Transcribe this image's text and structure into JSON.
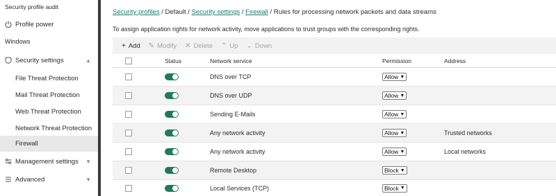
{
  "sidebar": {
    "items": [
      {
        "label": "Security profile audit",
        "type": "item",
        "icon": ""
      },
      {
        "label": "Profile power",
        "type": "item",
        "icon": "power-icon"
      },
      {
        "label": "Windows",
        "type": "section"
      },
      {
        "label": "Security settings",
        "type": "group",
        "icon": "shield-icon",
        "chevron": "up"
      },
      {
        "label": "File Threat Protection",
        "type": "subitem"
      },
      {
        "label": "Mail Threat Protection",
        "type": "subitem"
      },
      {
        "label": "Web Threat Protection",
        "type": "subitem"
      },
      {
        "label": "Network Threat Protection",
        "type": "subitem"
      },
      {
        "label": "Firewall",
        "type": "subitem",
        "active": true
      },
      {
        "label": "Management settings",
        "type": "group",
        "icon": "sliders-icon",
        "chevron": "down"
      },
      {
        "label": "Advanced",
        "type": "group",
        "icon": "list-icon",
        "chevron": "down"
      }
    ]
  },
  "breadcrumb": {
    "link1": "Security profiles",
    "sep1": "/",
    "plain1": "Default",
    "sep2": "/",
    "link2": "Security settings",
    "sep3": "/",
    "link3": "Firewall",
    "sep4": "/",
    "current": "Rules for processing network packets and data streams"
  },
  "description": "To assign application rights for network activity, move applications to trust groups with the corresponding rights.",
  "toolbar": {
    "add": "Add",
    "modify": "Modify",
    "delete": "Delete",
    "up": "Up",
    "down": "Down"
  },
  "table": {
    "headers": {
      "status": "Status",
      "service": "Network service",
      "permission": "Permission",
      "address": "Address"
    },
    "rows": [
      {
        "service": "DNS over TCP",
        "permission": "Allow",
        "address": "",
        "enabled": true
      },
      {
        "service": "DNS over UDP",
        "permission": "Allow",
        "address": "",
        "enabled": true
      },
      {
        "service": "Sending E-Mails",
        "permission": "Allow",
        "address": "",
        "enabled": true
      },
      {
        "service": "Any network activity",
        "permission": "Allow",
        "address": "Trusted networks",
        "enabled": true
      },
      {
        "service": "Any network activity",
        "permission": "Allow",
        "address": "Local networks",
        "enabled": true
      },
      {
        "service": "Remote Desktop",
        "permission": "Block",
        "address": "",
        "enabled": true
      },
      {
        "service": "Local Services (TCP)",
        "permission": "Block",
        "address": "",
        "enabled": true
      }
    ]
  },
  "colors": {
    "accent": "#1f7a5e",
    "link": "#1a7f67",
    "sidebar_separator": "#3a3a3a"
  }
}
